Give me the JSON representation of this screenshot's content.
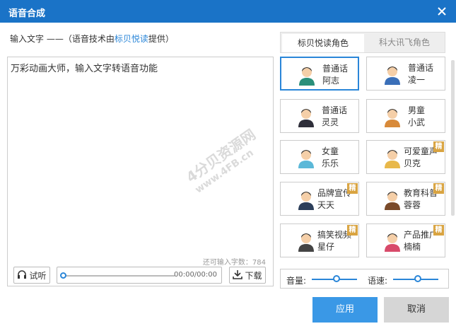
{
  "window": {
    "title": "语音合成"
  },
  "hint": {
    "prefix": "输入文字 ——（语音技术由",
    "link": "标贝悦读",
    "suffix": "提供）"
  },
  "editor": {
    "text": "万彩动画大师，输入文字转语音功能",
    "remain_label": "还可输入字数：784"
  },
  "player": {
    "try_label": "试听",
    "time": "00:00/00:00",
    "download_label": "下载",
    "progress": 0
  },
  "tabs": [
    {
      "label": "标贝悦读角色",
      "active": true
    },
    {
      "label": "科大讯飞角色",
      "active": false
    }
  ],
  "voices": [
    {
      "line1": "普通话",
      "line2": "阿志",
      "selected": true,
      "badge": ""
    },
    {
      "line1": "普通话",
      "line2": "凌一",
      "selected": false,
      "badge": ""
    },
    {
      "line1": "普通话",
      "line2": "灵灵",
      "selected": false,
      "badge": ""
    },
    {
      "line1": "男童",
      "line2": "小武",
      "selected": false,
      "badge": ""
    },
    {
      "line1": "女童",
      "line2": "乐乐",
      "selected": false,
      "badge": ""
    },
    {
      "line1": "可爱童声",
      "line2": "贝克",
      "selected": false,
      "badge": "精"
    },
    {
      "line1": "品牌宣传",
      "line2": "天天",
      "selected": false,
      "badge": "精"
    },
    {
      "line1": "教育科普",
      "line2": "蓉蓉",
      "selected": false,
      "badge": "精"
    },
    {
      "line1": "搞笑视频",
      "line2": "星仔",
      "selected": false,
      "badge": "精"
    },
    {
      "line1": "产品推广",
      "line2": "楠楠",
      "selected": false,
      "badge": "精"
    }
  ],
  "controls": {
    "volume_label": "音量:",
    "speed_label": "语速:",
    "volume": 0.55,
    "speed": 0.55
  },
  "buttons": {
    "apply": "应用",
    "cancel": "取消"
  },
  "watermark": {
    "line1": "4分贝资源网",
    "line2": "www.4FB.cn"
  },
  "colors": {
    "accent": "#2a86d8",
    "titlebar": "#1a73c7",
    "badge": "#d9a441"
  }
}
